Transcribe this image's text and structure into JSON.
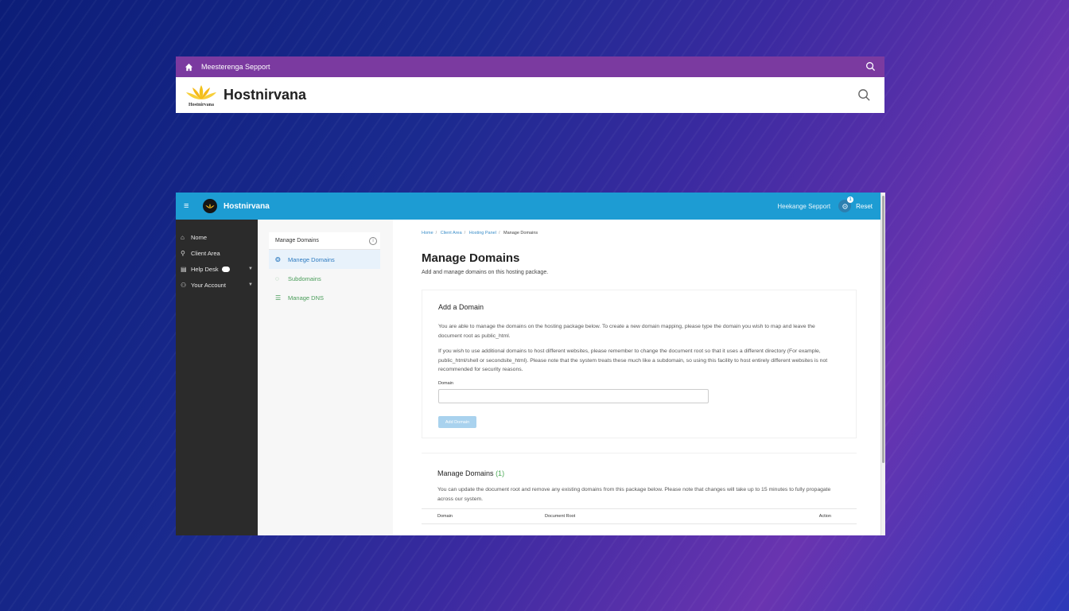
{
  "top_window": {
    "bar_title": "Meesterenga Sepport",
    "brand": "Hostnirvana",
    "logo_small_text": "Hostnirvana"
  },
  "app": {
    "brand": "Hostnirvana",
    "support": "Heekange Sepport",
    "notif_count": "1",
    "reset": "Reset"
  },
  "sidebar": {
    "items": [
      {
        "icon": "⌂",
        "label": "Nome"
      },
      {
        "icon": "⚲",
        "label": "Client Area"
      },
      {
        "icon": "▤",
        "label": "Help Desk"
      },
      {
        "icon": "⚇",
        "label": "Your Account"
      }
    ]
  },
  "subnav": {
    "title": "Manage Domains",
    "items": [
      {
        "icon": "❂",
        "label": "Manege Domains"
      },
      {
        "icon": "◌",
        "label": "Subdomains"
      },
      {
        "icon": "☰",
        "label": "Manage DNS"
      }
    ]
  },
  "breadcrumb": [
    "Home",
    "Client Area",
    "Hosting Panel",
    "Manage Domains"
  ],
  "main": {
    "title": "Manage Domains",
    "subtitle": "Add and manage domains on this hosting package.",
    "add": {
      "heading": "Add a Domain",
      "para1": "You are able to manage the domains on the hosting package below. To create a new domain mapping, please type the domain you wish to map and leave the document root as public_html.",
      "para2": "If you wish to use additional domains to host different websites, please remember to change the document root so that it uses a different directory (For example, public_html/shell or secondsite_html). Please note that the system treats these much like a subdomain, so using this facility to host entirely different websites is not recommended for security reasons.",
      "field_label": "Domain",
      "field_placeholder": "",
      "button": "Add Domain"
    },
    "manage": {
      "heading": "Manage Domains",
      "count": "(1)",
      "para": "You can update the document root and remove any existing domains from this package below. Please note that changes will take up to 15 minutes to fully propagate across our system.",
      "columns": [
        "Domain",
        "Document Root",
        "Action"
      ]
    }
  },
  "colors": {
    "top_bar": "#7b3aa0",
    "app_header": "#1d9cd3",
    "sidebar": "#2b2b2b",
    "accent_green": "#4a9d5a",
    "link_blue": "#2e7bc0"
  }
}
